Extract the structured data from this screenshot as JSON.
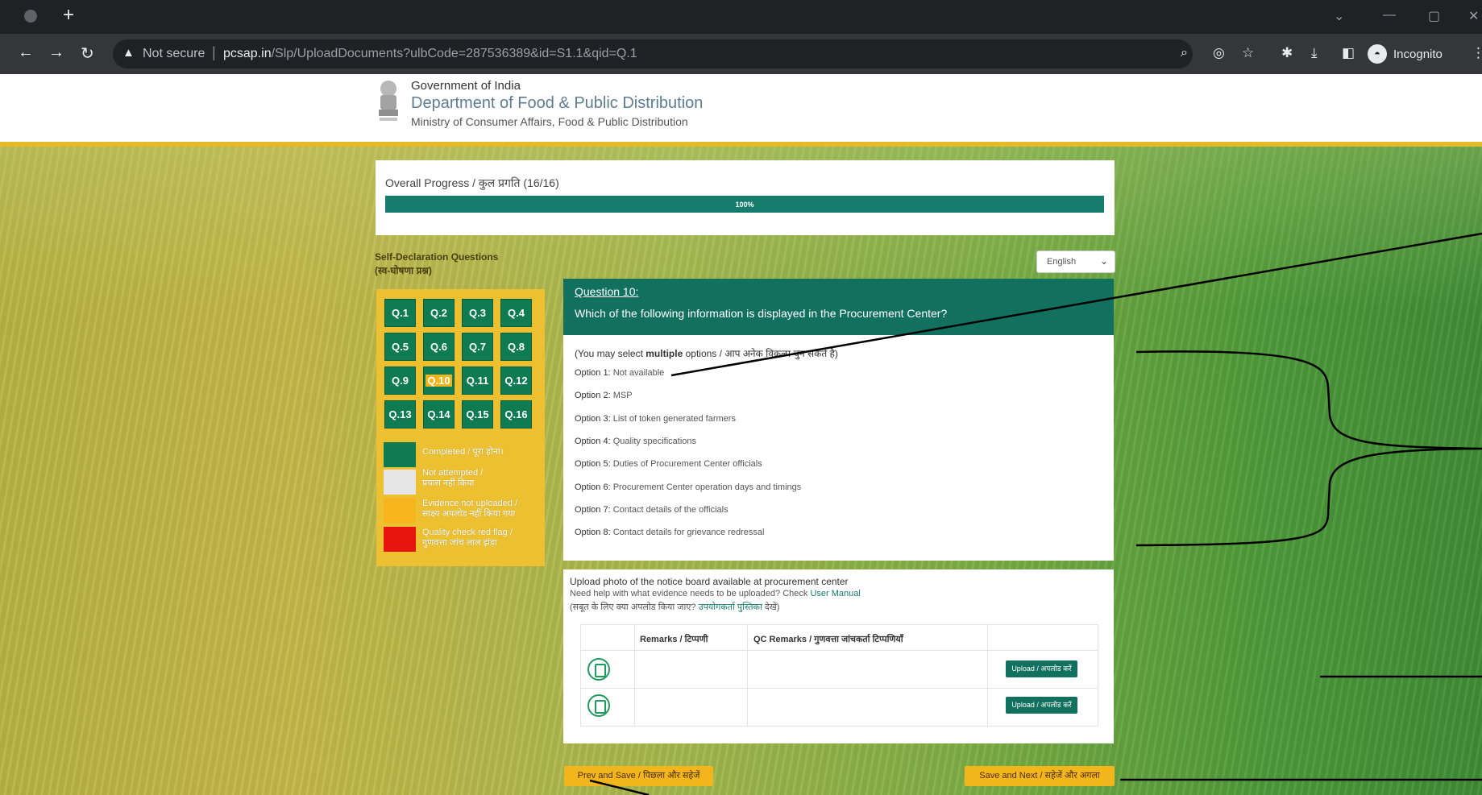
{
  "browser": {
    "not_secure": "Not secure",
    "url_host": "pcsap.in",
    "url_path": "/Slp/UploadDocuments?ulbCode=287536389&id=S1.1&qid=Q.1",
    "incognito": "Incognito"
  },
  "header": {
    "gov": "Government of India",
    "dept": "Department of Food & Public Distribution",
    "ministry": "Ministry of Consumer Affairs, Food & Public Distribution"
  },
  "progress": {
    "title": "Overall Progress / कुल प्रगति (16/16)",
    "label": "100%",
    "fraction": 1.0
  },
  "sidebar": {
    "heading_en": "Self-Declaration Questions",
    "heading_hi": "(स्व-घोषणा प्रश्न)",
    "questions": [
      "Q.1",
      "Q.2",
      "Q.3",
      "Q.4",
      "Q.5",
      "Q.6",
      "Q.7",
      "Q.8",
      "Q.9",
      "Q.10",
      "Q.11",
      "Q.12",
      "Q.13",
      "Q.14",
      "Q.15",
      "Q.16"
    ],
    "current": "Q.10",
    "legend": [
      {
        "line1": "Completed / पूरा होना।",
        "line2": "",
        "color": "#0f7b52"
      },
      {
        "line1": "Not attempted /",
        "line2": "प्रयास नहीं किया",
        "color": "#e6e6e6"
      },
      {
        "line1": "Evidence not uploaded /",
        "line2": "साक्ष्य अपलोड नहीं किया गया",
        "color": "#f7b51d"
      },
      {
        "line1": "Quality check red flag /",
        "line2": "गुणवत्ता जांच लाल झंडा",
        "color": "#e8150f"
      }
    ]
  },
  "language": {
    "selected": "English"
  },
  "question": {
    "number": "Question 10:",
    "text": "Which of the following information is displayed in the Procurement Center?",
    "note_prefix": "(You may select ",
    "note_bold": "multiple",
    "note_suffix": " options / आप अनेक विकल्प चुन सकते है)",
    "options": [
      {
        "label": "Option 1:",
        "text": " Not available"
      },
      {
        "label": "Option 2:",
        "text": " MSP"
      },
      {
        "label": "Option 3:",
        "text": " List of token generated farmers"
      },
      {
        "label": "Option 4:",
        "text": " Quality specifications"
      },
      {
        "label": "Option 5:",
        "text": " Duties of Procurement Center officials"
      },
      {
        "label": "Option 6:",
        "text": " Procurement Center operation days and timings"
      },
      {
        "label": "Option 7:",
        "text": " Contact details of the officials"
      },
      {
        "label": "Option 8:",
        "text": " Contact details for grievance redressal"
      }
    ]
  },
  "upload": {
    "title": "Upload photo of the notice board available at procurement center",
    "help_prefix": "Need help with what evidence needs to be uploaded? Check ",
    "help_link": "User Manual",
    "help_hi_prefix": "(सबूत के लिए क्या अपलोड किया जाए? ",
    "help_hi_link": "उपयोगकर्ता पुस्तिका",
    "help_hi_suffix": " देखें)",
    "col_remarks": "Remarks / टिप्पणी",
    "col_qc": "QC Remarks / गुणवत्ता जांचकर्ता टिप्पणियाँ",
    "rows": [
      {
        "button": "Upload / अपलोड करें"
      },
      {
        "button": "Upload / अपलोड करें"
      }
    ]
  },
  "footer": {
    "prev": "Prev and Save / पिछला और सहेजें",
    "next": "Save and Next / सहेजें और अगला"
  }
}
